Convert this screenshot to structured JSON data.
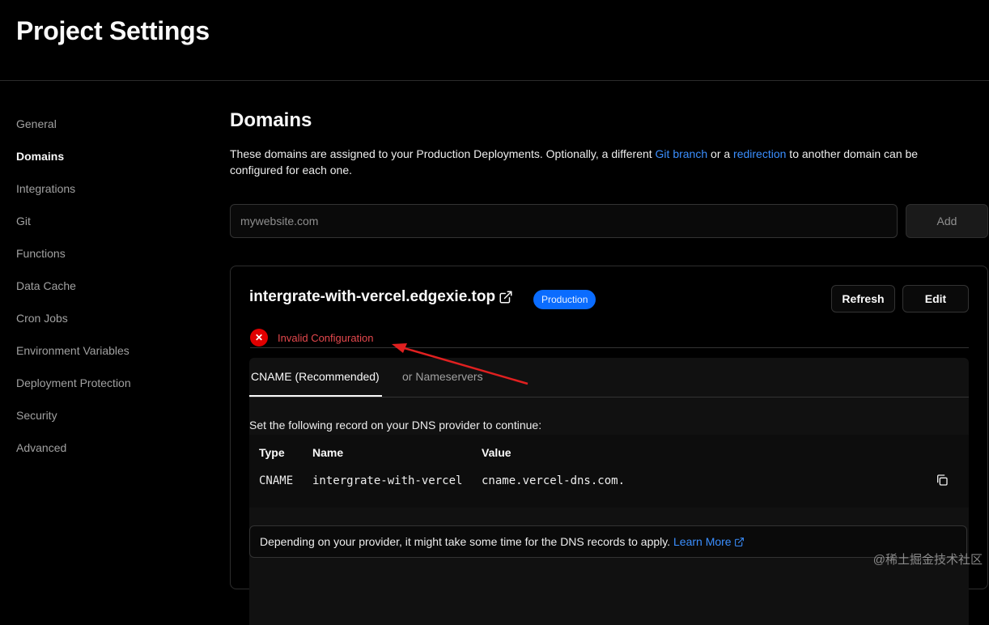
{
  "page": {
    "title": "Project Settings"
  },
  "sidebar": {
    "items": [
      {
        "label": "General"
      },
      {
        "label": "Domains",
        "active": true
      },
      {
        "label": "Integrations"
      },
      {
        "label": "Git"
      },
      {
        "label": "Functions"
      },
      {
        "label": "Data Cache"
      },
      {
        "label": "Cron Jobs"
      },
      {
        "label": "Environment Variables"
      },
      {
        "label": "Deployment Protection"
      },
      {
        "label": "Security"
      },
      {
        "label": "Advanced"
      }
    ]
  },
  "domains": {
    "title": "Domains",
    "description": {
      "part1": "These domains are assigned to your Production Deployments. Optionally, a different ",
      "link1": "Git branch",
      "part2": " or a ",
      "link2": "redirection",
      "part3": " to another domain can be configured for each one."
    },
    "input": {
      "placeholder": "mywebsite.com",
      "value": ""
    },
    "add_label": "Add"
  },
  "domain_card": {
    "name": "intergrate-with-vercel.edgexie.top",
    "badge": "Production",
    "refresh_label": "Refresh",
    "edit_label": "Edit",
    "status": "Invalid Configuration",
    "tabs": [
      {
        "label": "CNAME (Recommended)",
        "active": true
      },
      {
        "label": "or Nameservers",
        "active": false
      }
    ],
    "instruction": "Set the following record on your DNS provider to continue:",
    "table": {
      "headers": [
        "Type",
        "Name",
        "Value"
      ],
      "rows": [
        [
          "CNAME",
          "intergrate-with-vercel",
          "cname.vercel-dns.com."
        ]
      ]
    },
    "note": {
      "text": "Depending on your provider, it might take some time for the DNS records to apply. ",
      "link": "Learn More"
    }
  },
  "watermark": "@稀土掘金技术社区",
  "colors": {
    "background": "#000000",
    "accent_link": "#3b8fff",
    "badge": "#0a6cff",
    "error": "#e00000",
    "annotation_arrow": "#e02020"
  }
}
